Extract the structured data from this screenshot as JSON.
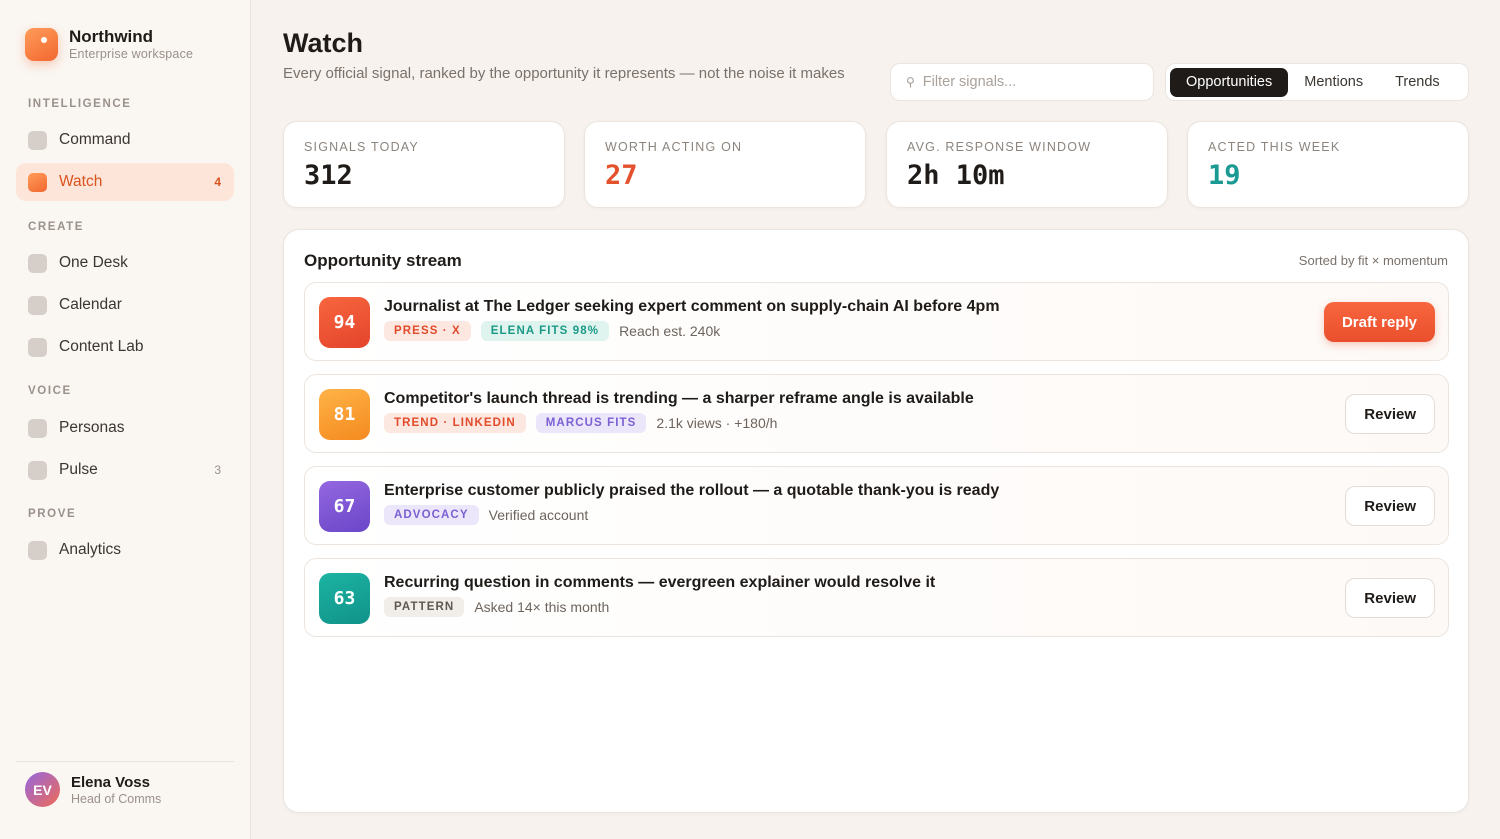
{
  "brand": {
    "name": "Northwind",
    "subtitle": "Enterprise workspace"
  },
  "sidebar": {
    "sections": [
      {
        "label": "INTELLIGENCE",
        "items": [
          {
            "label": "Command",
            "count": ""
          },
          {
            "label": "Watch",
            "count": "4",
            "active": true
          }
        ]
      },
      {
        "label": "CREATE",
        "items": [
          {
            "label": "One Desk",
            "count": ""
          },
          {
            "label": "Calendar",
            "count": ""
          },
          {
            "label": "Content Lab",
            "count": ""
          }
        ]
      },
      {
        "label": "VOICE",
        "items": [
          {
            "label": "Personas",
            "count": ""
          },
          {
            "label": "Pulse",
            "count": "3"
          }
        ]
      },
      {
        "label": "PROVE",
        "items": [
          {
            "label": "Analytics",
            "count": ""
          }
        ]
      }
    ]
  },
  "user": {
    "initials": "EV",
    "name": "Elena Voss",
    "role": "Head of Comms"
  },
  "header": {
    "title": "Watch",
    "subtitle": "Every official signal, ranked by the opportunity it represents — not the noise it makes",
    "search_placeholder": "Filter signals...",
    "tabs": [
      {
        "label": "Opportunities",
        "active": true
      },
      {
        "label": "Mentions"
      },
      {
        "label": "Trends"
      }
    ]
  },
  "stats": [
    {
      "label": "SIGNALS TODAY",
      "value": "312",
      "color": "#1f1b18"
    },
    {
      "label": "WORTH ACTING ON",
      "value": "27",
      "color": "#e4512d"
    },
    {
      "label": "AVG. RESPONSE WINDOW",
      "value": "2h 10m",
      "color": "#1f1b18"
    },
    {
      "label": "ACTED THIS WEEK",
      "value": "19",
      "color": "#1a9a92"
    }
  ],
  "stream": {
    "title": "Opportunity stream",
    "sort_label": "Sorted by fit × momentum",
    "items": [
      {
        "score": "94",
        "score_gradient": [
          "#f7663e",
          "#e4442c"
        ],
        "title": "Journalist at The Ledger seeking expert comment on supply-chain AI before 4pm",
        "chips": [
          {
            "label": "PRESS · X",
            "bg": "#fde7e1",
            "fg": "#e14b2a"
          },
          {
            "label": "ELENA FITS 98%",
            "bg": "#dff3ef",
            "fg": "#1a9a86"
          }
        ],
        "meta": "Reach est. 240k",
        "action": "Draft reply",
        "primary": true
      },
      {
        "score": "81",
        "score_gradient": [
          "#ffb347",
          "#f48a1f"
        ],
        "title": "Competitor's launch thread is trending — a sharper reframe angle is available",
        "chips": [
          {
            "label": "TREND · LINKEDIN",
            "bg": "#fde7e1",
            "fg": "#e14b2a"
          },
          {
            "label": "MARCUS FITS",
            "bg": "#ece6fb",
            "fg": "#7b5fd3"
          }
        ],
        "meta": "2.1k views · +180/h",
        "action": "Review",
        "primary": false
      },
      {
        "score": "67",
        "score_gradient": [
          "#9467e0",
          "#6a46c8"
        ],
        "title": "Enterprise customer publicly praised the rollout — a quotable thank-you is ready",
        "chips": [
          {
            "label": "ADVOCACY",
            "bg": "#ece6fb",
            "fg": "#7b5fd3"
          }
        ],
        "meta": "Verified account",
        "action": "Review",
        "primary": false
      },
      {
        "score": "63",
        "score_gradient": [
          "#1cb3a3",
          "#11938a"
        ],
        "title": "Recurring question in comments — evergreen explainer would resolve it",
        "chips": [
          {
            "label": "PATTERN",
            "bg": "#f1ede9",
            "fg": "#5f5750"
          }
        ],
        "meta": "Asked 14× this month",
        "action": "Review",
        "primary": false
      }
    ]
  }
}
